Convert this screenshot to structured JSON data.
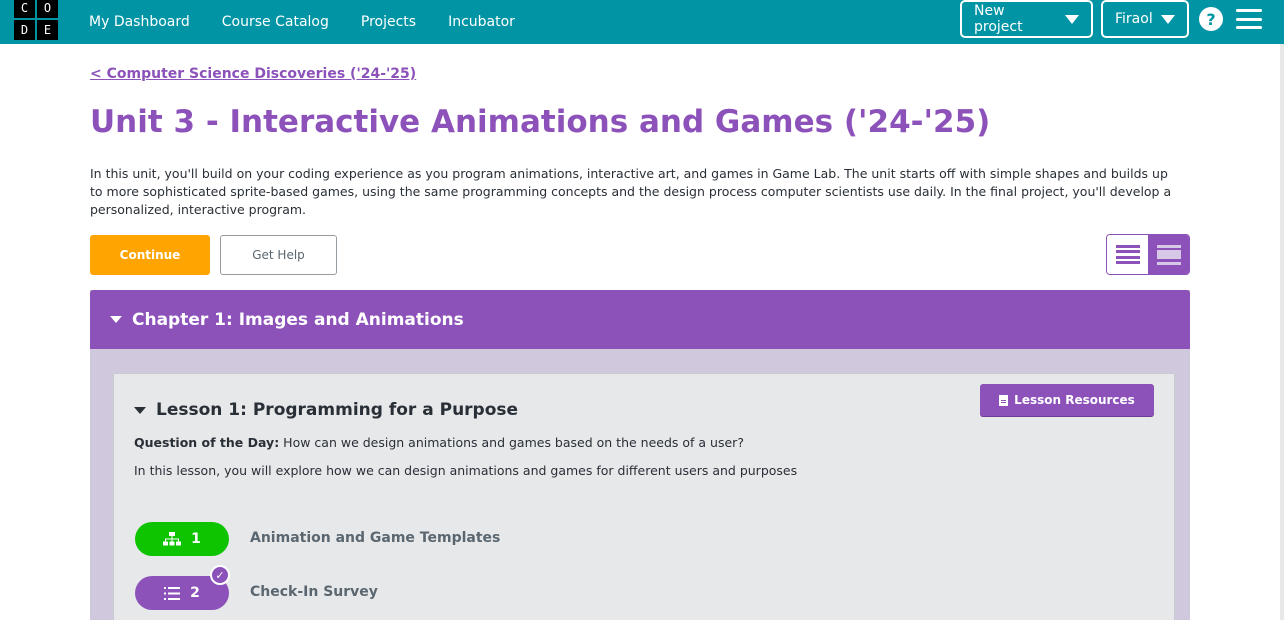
{
  "logo": {
    "letters": [
      "C",
      "O",
      "D",
      "E"
    ]
  },
  "nav": {
    "items": [
      "My Dashboard",
      "Course Catalog",
      "Projects",
      "Incubator"
    ]
  },
  "header": {
    "new_project": "New project",
    "user": "Firaol",
    "help": "?"
  },
  "breadcrumb": "< Computer Science Discoveries ('24-'25)",
  "unit": {
    "title": "Unit 3 - Interactive Animations and Games ('24-'25)",
    "description": "In this unit, you'll build on your coding experience as you program animations, interactive art, and games in Game Lab. The unit starts off with simple shapes and builds up to more sophisticated sprite-based games, using the same programming concepts and the design process computer scientists use daily. In the final project, you'll develop a personalized, interactive program."
  },
  "actions": {
    "continue": "Continue",
    "get_help": "Get Help"
  },
  "chapter": {
    "title": "Chapter 1: Images and Animations"
  },
  "lesson": {
    "title": "Lesson 1: Programming for a Purpose",
    "resources": "Lesson Resources",
    "qotd_label": "Question of the Day:",
    "qotd_text": " How can we design animations and games based on the needs of a user?",
    "overview": "In this lesson, you will explore how we can design animations and games for different users and purposes",
    "levels": [
      {
        "number": "1",
        "name": "Animation and Game Templates",
        "icon": "sitemap-icon",
        "color": "#0ec300"
      },
      {
        "number": "2",
        "name": "Check-In Survey",
        "icon": "list-icon",
        "color": "#8c52ba",
        "completed": true
      }
    ]
  },
  "colors": {
    "brand_teal": "#0094a4",
    "purple": "#8c52ba",
    "orange": "#ffa400",
    "green": "#0ec300"
  }
}
